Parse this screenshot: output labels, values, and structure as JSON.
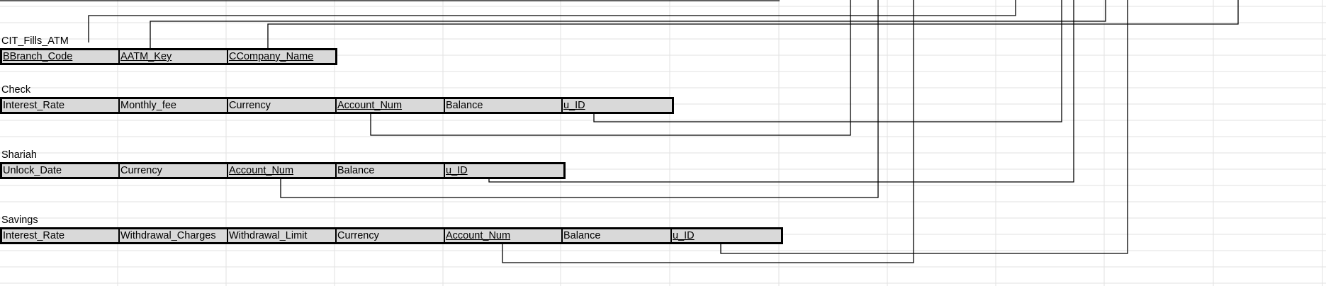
{
  "diagram": {
    "tables": [
      {
        "name": "CIT_Fills_ATM",
        "fields": [
          {
            "label": "BBranch_Code",
            "key": true
          },
          {
            "label": "AATM_Key",
            "key": true
          },
          {
            "label": "CCompany_Name",
            "key": true
          }
        ]
      },
      {
        "name": "Check",
        "fields": [
          {
            "label": "Interest_Rate",
            "key": false
          },
          {
            "label": "Monthly_fee",
            "key": false
          },
          {
            "label": "Currency",
            "key": false
          },
          {
            "label": "Account_Num",
            "key": true
          },
          {
            "label": "Balance",
            "key": false
          },
          {
            "label": "u_ID",
            "key": true
          }
        ]
      },
      {
        "name": "Shariah",
        "fields": [
          {
            "label": "Unlock_Date",
            "key": false
          },
          {
            "label": "Currency",
            "key": false
          },
          {
            "label": "Account_Num",
            "key": true
          },
          {
            "label": "Balance",
            "key": false
          },
          {
            "label": "u_ID",
            "key": true
          }
        ]
      },
      {
        "name": "Savings",
        "fields": [
          {
            "label": "Interest_Rate",
            "key": false
          },
          {
            "label": "Withdrawal_Charges",
            "key": false
          },
          {
            "label": "Withdrawal_Limit",
            "key": false
          },
          {
            "label": "Currency",
            "key": false
          },
          {
            "label": "Account_Num",
            "key": true
          },
          {
            "label": "Balance",
            "key": false
          },
          {
            "label": "u_ID",
            "key": true
          }
        ]
      }
    ]
  }
}
